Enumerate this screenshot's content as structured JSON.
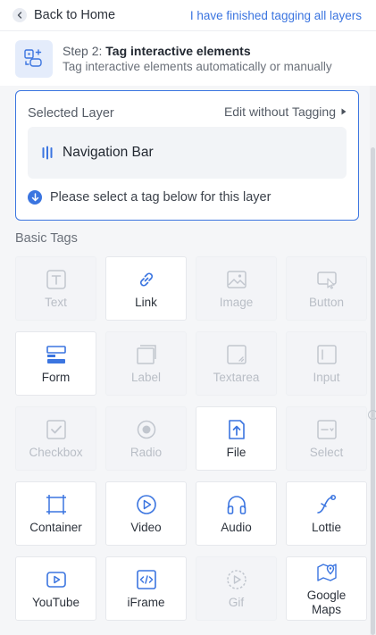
{
  "topbar": {
    "back_label": "Back to Home",
    "finish_label": "I have finished tagging all layers"
  },
  "step": {
    "prefix": "Step 2: ",
    "title": "Tag interactive elements",
    "subtitle": "Tag interactive elements automatically or manually"
  },
  "selected_layer": {
    "title": "Selected Layer",
    "edit_label": "Edit without Tagging",
    "layer_name": "Navigation Bar",
    "hint": "Please select a tag below for this layer"
  },
  "basic_tags": {
    "title": "Basic Tags",
    "items": [
      {
        "label": "Text",
        "icon": "text-icon",
        "enabled": false
      },
      {
        "label": "Link",
        "icon": "link-icon",
        "enabled": true
      },
      {
        "label": "Image",
        "icon": "image-icon",
        "enabled": false
      },
      {
        "label": "Button",
        "icon": "button-icon",
        "enabled": false
      },
      {
        "label": "Form",
        "icon": "form-icon",
        "enabled": true
      },
      {
        "label": "Label",
        "icon": "label-icon",
        "enabled": false
      },
      {
        "label": "Textarea",
        "icon": "textarea-icon",
        "enabled": false
      },
      {
        "label": "Input",
        "icon": "input-icon",
        "enabled": false
      },
      {
        "label": "Checkbox",
        "icon": "checkbox-icon",
        "enabled": false
      },
      {
        "label": "Radio",
        "icon": "radio-icon",
        "enabled": false
      },
      {
        "label": "File",
        "icon": "file-icon",
        "enabled": true
      },
      {
        "label": "Select",
        "icon": "select-icon",
        "enabled": false
      },
      {
        "label": "Container",
        "icon": "container-icon",
        "enabled": true
      },
      {
        "label": "Video",
        "icon": "video-icon",
        "enabled": true
      },
      {
        "label": "Audio",
        "icon": "audio-icon",
        "enabled": true
      },
      {
        "label": "Lottie",
        "icon": "lottie-icon",
        "enabled": true
      },
      {
        "label": "YouTube",
        "icon": "youtube-icon",
        "enabled": true
      },
      {
        "label": "iFrame",
        "icon": "iframe-icon",
        "enabled": true
      },
      {
        "label": "Gif",
        "icon": "gif-icon",
        "enabled": false
      },
      {
        "label": "Google Maps",
        "icon": "google-maps-icon",
        "enabled": true
      }
    ]
  },
  "colors": {
    "accent": "#3b75e0",
    "disabled_text": "#b9bec6",
    "panel_bg": "#f5f6f8"
  }
}
